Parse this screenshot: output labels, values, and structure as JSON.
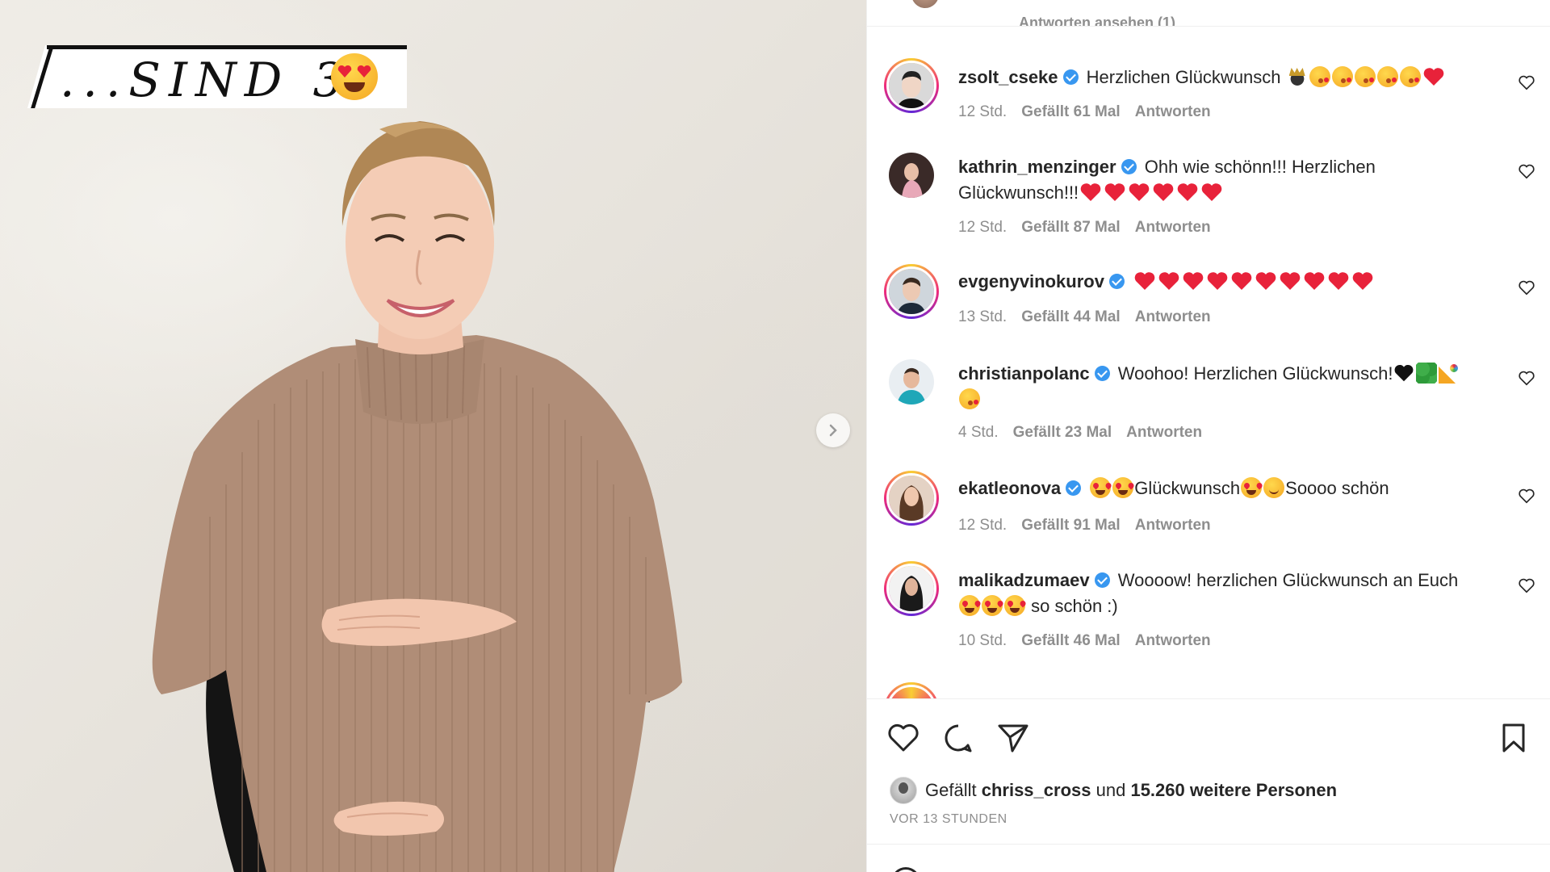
{
  "post": {
    "overlay_text": "...SIND 3",
    "overlay_emoji": "heart-eyes-emoji"
  },
  "thread": {
    "view_replies_label": "Antworten ansehen (1)"
  },
  "comments": [
    {
      "username": "zsolt_cseke",
      "text": "Herzlichen Glückwunsch",
      "emojis": [
        "crown",
        "kiss",
        "kiss",
        "kiss",
        "kiss",
        "kiss",
        "heart"
      ],
      "time": "12 Std.",
      "likes": "Gefällt 61 Mal",
      "reply": "Antworten"
    },
    {
      "username": "kathrin_menzinger",
      "text": "Ohh wie schönn!!! Herzlichen Glückwunsch!!!",
      "emojis": [
        "heart",
        "heart",
        "heart",
        "heart",
        "heart",
        "heart"
      ],
      "time": "12 Std.",
      "likes": "Gefällt 87 Mal",
      "reply": "Antworten"
    },
    {
      "username": "evgenyvinokurov",
      "text": "",
      "emojis": [
        "heart",
        "heart",
        "heart",
        "heart",
        "heart",
        "heart",
        "heart",
        "heart",
        "heart",
        "heart"
      ],
      "time": "13 Std.",
      "likes": "Gefällt 44 Mal",
      "reply": "Antworten"
    },
    {
      "username": "christianpolanc",
      "text": "Woohoo! Herzlichen Glückwunsch!",
      "emojis": [
        "black-heart",
        "four-leaf-clover",
        "party-popper",
        "kiss"
      ],
      "time": "4 Std.",
      "likes": "Gefällt 23 Mal",
      "reply": "Antworten"
    },
    {
      "username": "ekatleonova",
      "text_parts": [
        "Glückwunsch",
        "Soooo schön"
      ],
      "emojis": [
        "star-eyes",
        "star-eyes",
        "star-eyes",
        "hug"
      ],
      "time": "12 Std.",
      "likes": "Gefällt 91 Mal",
      "reply": "Antworten"
    },
    {
      "username": "malikadzumaev",
      "text": "Woooow! herzlichen Glückwunsch an Euch",
      "text_after": "so schön :)",
      "emojis": [
        "star-eyes",
        "star-eyes",
        "star-eyes"
      ],
      "time": "10 Std.",
      "likes": "Gefällt 46 Mal",
      "reply": "Antworten"
    }
  ],
  "actions": {
    "like_icon": "heart-outline-icon",
    "comment_icon": "comment-bubble-icon",
    "share_icon": "paper-plane-icon",
    "save_icon": "bookmark-icon"
  },
  "likes_summary": {
    "prefix": "Gefällt",
    "user": "chriss_cross",
    "middle": "und",
    "count": "15.260 weitere Personen"
  },
  "post_time": "VOR 13 STUNDEN",
  "colors": {
    "verified": "#3897f0",
    "muted_text": "#8e8e8e",
    "text": "#262626",
    "heart_red": "#e8223a",
    "sweater": "#b08d77"
  }
}
